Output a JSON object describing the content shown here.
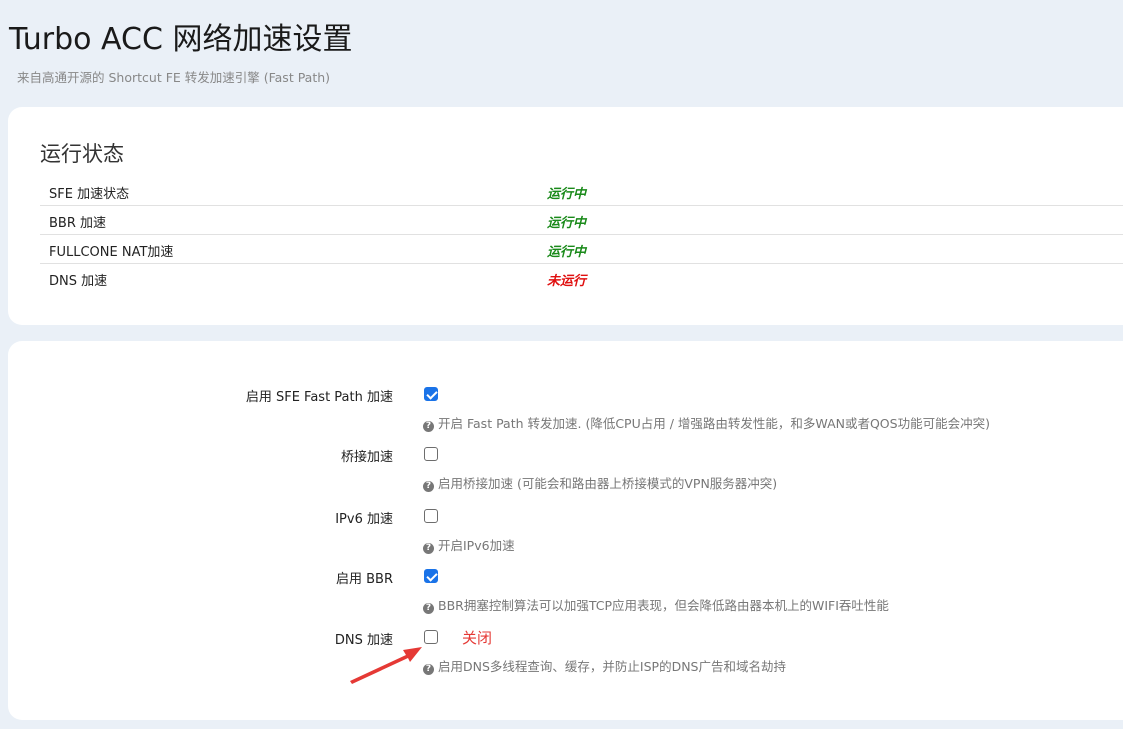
{
  "header": {
    "title": "Turbo ACC 网络加速设置",
    "description": "来自高通开源的 Shortcut FE 转发加速引擎 (Fast Path)"
  },
  "status_section": {
    "title": "运行状态",
    "rows": [
      {
        "label": "SFE 加速状态",
        "value": "运行中",
        "state": "running"
      },
      {
        "label": "BBR 加速",
        "value": "运行中",
        "state": "running"
      },
      {
        "label": "FULLCONE NAT加速",
        "value": "运行中",
        "state": "running"
      },
      {
        "label": "DNS 加速",
        "value": "未运行",
        "state": "stopped"
      }
    ]
  },
  "settings": {
    "options": [
      {
        "label": "启用 SFE Fast Path 加速",
        "checked": true,
        "hint": "开启 Fast Path 转发加速. (降低CPU占用 / 增强路由转发性能，和多WAN或者QOS功能可能会冲突)"
      },
      {
        "label": "桥接加速",
        "checked": false,
        "hint": "启用桥接加速 (可能会和路由器上桥接模式的VPN服务器冲突)"
      },
      {
        "label": "IPv6 加速",
        "checked": false,
        "hint": "开启IPv6加速"
      },
      {
        "label": "启用 BBR",
        "checked": true,
        "hint": "BBR拥塞控制算法可以加强TCP应用表现，但会降低路由器本机上的WIFI吞吐性能"
      },
      {
        "label": "DNS 加速",
        "checked": false,
        "hint": "启用DNS多线程查询、缓存，并防止ISP的DNS广告和域名劫持"
      }
    ],
    "annotation": "关闭"
  },
  "colors": {
    "accent": "#1a73e8",
    "running": "#1a8a1a",
    "stopped": "#e01010",
    "annotation": "#e53935"
  },
  "icons": {
    "help": "question-circle-icon",
    "annotation_arrow": "red-arrow-icon"
  }
}
